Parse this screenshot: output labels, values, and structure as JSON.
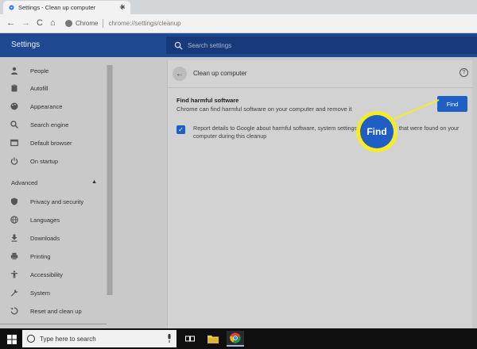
{
  "browser": {
    "tab_title": "Settings - Clean up computer",
    "tab_close": "✕",
    "new_tab": "+",
    "nav_back": "←",
    "nav_forward": "→",
    "nav_reload": "C",
    "nav_home": "⌂",
    "url_scheme": "Chrome",
    "url_path": "chrome://settings/cleanup"
  },
  "settings": {
    "title": "Settings",
    "search_placeholder": "Search settings"
  },
  "sidebar": {
    "items": [
      {
        "label": "People",
        "icon": "person-icon"
      },
      {
        "label": "Autofill",
        "icon": "clipboard-icon"
      },
      {
        "label": "Appearance",
        "icon": "palette-icon"
      },
      {
        "label": "Search engine",
        "icon": "search-icon"
      },
      {
        "label": "Default browser",
        "icon": "browser-icon"
      },
      {
        "label": "On startup",
        "icon": "power-icon"
      }
    ],
    "advanced_label": "Advanced",
    "advanced_caret": "▲",
    "advanced_items": [
      {
        "label": "Privacy and security",
        "icon": "shield-icon"
      },
      {
        "label": "Languages",
        "icon": "globe-icon"
      },
      {
        "label": "Downloads",
        "icon": "download-icon"
      },
      {
        "label": "Printing",
        "icon": "printer-icon"
      },
      {
        "label": "Accessibility",
        "icon": "accessibility-icon"
      },
      {
        "label": "System",
        "icon": "wrench-icon"
      },
      {
        "label": "Reset and clean up",
        "icon": "reset-icon"
      }
    ]
  },
  "page": {
    "back_glyph": "←",
    "title": "Clean up computer",
    "help_glyph": "?",
    "find_title": "Find harmful software",
    "find_description": "Chrome can find harmful software on your computer and remove it",
    "find_button": "Find",
    "checkbox_checked": true,
    "checkbox_glyph": "✓",
    "report_text": "Report details to Google about harmful software, system settings, and processes that were found on your computer during this cleanup"
  },
  "callout": {
    "label": "Find",
    "ring_color": "#f6ec26"
  },
  "taskbar": {
    "search_placeholder": "Type here to search"
  },
  "colors": {
    "header": "#1f4a92",
    "accent": "#1f5fc5"
  }
}
